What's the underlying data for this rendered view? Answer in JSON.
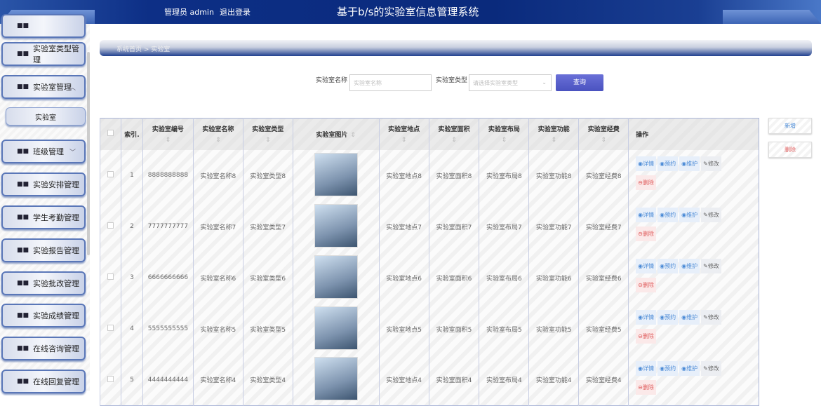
{
  "header": {
    "user": "管理员 admin",
    "logout": "退出登录",
    "title": "基于b/s的实验室信息管理系统"
  },
  "sidebar": {
    "items": [
      {
        "label": "",
        "chev": ""
      },
      {
        "label": "实验室类型管理",
        "chev": ""
      },
      {
        "label": "实验室管理",
        "chev": "^"
      },
      {
        "label": "实验室",
        "sub": true
      },
      {
        "label": "班级管理",
        "chev": "v"
      },
      {
        "label": "实验安排管理",
        "chev": "v"
      },
      {
        "label": "学生考勤管理",
        "chev": "v"
      },
      {
        "label": "实验报告管理",
        "chev": "v"
      },
      {
        "label": "实验批改管理",
        "chev": "v"
      },
      {
        "label": "实验成绩管理",
        "chev": "v"
      },
      {
        "label": "在线咨询管理",
        "chev": "v"
      },
      {
        "label": "在线回复管理",
        "chev": "v"
      }
    ]
  },
  "breadcrumb": "系统首页 > 实验室",
  "search": {
    "name_label": "实验室名称",
    "name_placeholder": "实验室名称",
    "type_label": "实验室类型",
    "type_placeholder": "请选择实验室类型",
    "query": "查询"
  },
  "actions": {
    "add": "新增",
    "delete": "删除"
  },
  "table": {
    "headers": [
      "索引.",
      "实验室编号",
      "实验室名称",
      "实验室类型",
      "实验室图片",
      "实验室地点",
      "实验室面积",
      "实验室布局",
      "实验室功能",
      "实验室经费",
      "操作"
    ],
    "op_labels": [
      "详情",
      "预约",
      "维护",
      "修改",
      "删除"
    ],
    "rows": [
      [
        "1",
        "8888888888",
        "实验室名称8",
        "实验室类型8",
        "实验室地点8",
        "实验室面积8",
        "实验室布局8",
        "实验室功能8",
        "实验室经费8"
      ],
      [
        "2",
        "7777777777",
        "实验室名称7",
        "实验室类型7",
        "实验室地点7",
        "实验室面积7",
        "实验室布局7",
        "实验室功能7",
        "实验室经费7"
      ],
      [
        "3",
        "6666666666",
        "实验室名称6",
        "实验室类型6",
        "实验室地点6",
        "实验室面积6",
        "实验室布局6",
        "实验室功能6",
        "实验室经费6"
      ],
      [
        "4",
        "5555555555",
        "实验室名称5",
        "实验室类型5",
        "实验室地点5",
        "实验室面积5",
        "实验室布局5",
        "实验室功能5",
        "实验室经费5"
      ],
      [
        "5",
        "4444444444",
        "实验室名称4",
        "实验室类型4",
        "实验室地点4",
        "实验室面积4",
        "实验室布局4",
        "实验室功能4",
        "实验室经费4"
      ]
    ]
  }
}
